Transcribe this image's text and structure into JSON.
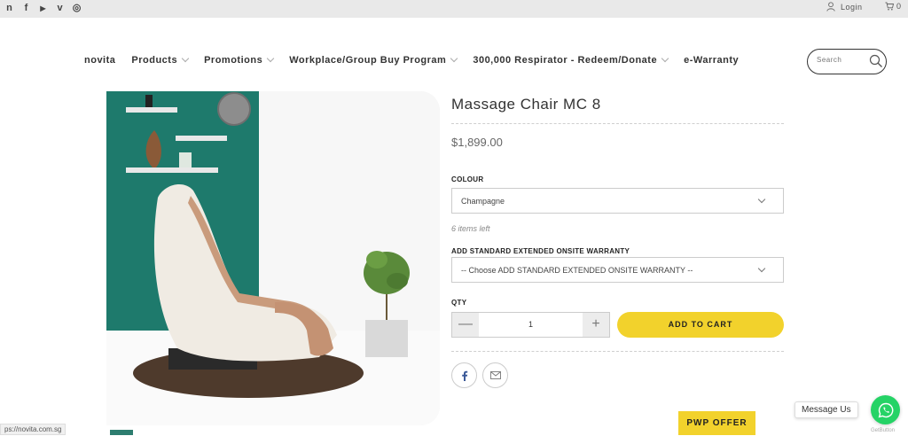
{
  "topbar": {
    "social": [
      {
        "icon": "novita-icon",
        "glyph": "n"
      },
      {
        "icon": "facebook-icon",
        "glyph": "f"
      },
      {
        "icon": "youtube-icon",
        "glyph": "▶"
      },
      {
        "icon": "vimeo-icon",
        "glyph": "v"
      },
      {
        "icon": "instagram-icon",
        "glyph": "◎"
      }
    ],
    "login_label": "Login",
    "cart_count": "0"
  },
  "nav": {
    "items": [
      {
        "label": "novita",
        "has_dropdown": false
      },
      {
        "label": "Products",
        "has_dropdown": true
      },
      {
        "label": "Promotions",
        "has_dropdown": true
      },
      {
        "label": "Workplace/Group Buy Program",
        "has_dropdown": true
      },
      {
        "label": "300,000 Respirator - Redeem/Donate",
        "has_dropdown": true
      },
      {
        "label": "e-Warranty",
        "has_dropdown": false
      }
    ],
    "search_placeholder": "Search"
  },
  "product": {
    "title": "Massage Chair MC 8",
    "price": "$1,899.00",
    "colour_label": "COLOUR",
    "colour_value": "Champagne",
    "stock_text": "6 items left",
    "warranty_label": "ADD STANDARD EXTENDED ONSITE WARRANTY",
    "warranty_value": "-- Choose ADD STANDARD EXTENDED ONSITE WARRANTY --",
    "qty_label": "QTY",
    "qty_value": "1",
    "qty_minus": "—",
    "qty_plus": "+",
    "add_to_cart": "ADD TO CART",
    "pwp_offer": "PWP OFFER"
  },
  "chat": {
    "message_label": "Message Us",
    "getbutton_label": "GetButton"
  },
  "statusbar": {
    "url": "ps://novita.com.sg"
  },
  "colors": {
    "accent_yellow": "#f2d22c",
    "whatsapp_green": "#25d366",
    "wall_teal": "#1e7a6c"
  }
}
